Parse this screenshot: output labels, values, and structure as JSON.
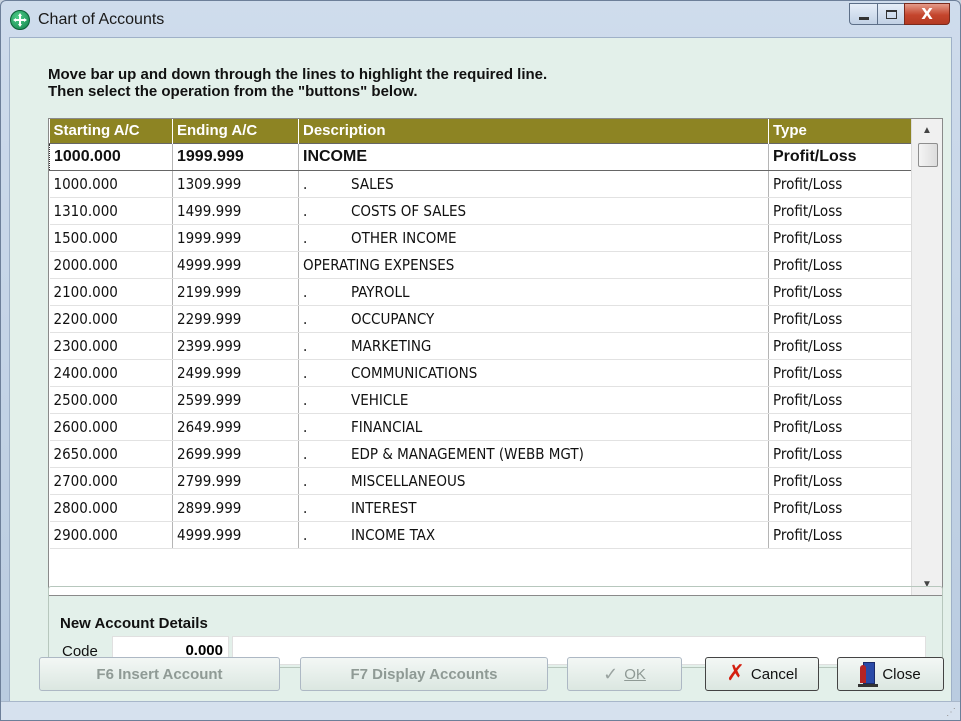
{
  "window": {
    "title": "Chart of Accounts",
    "controls": {
      "minimize": "—",
      "maximize": "□",
      "close": "X"
    }
  },
  "instructions": {
    "line1": "Move bar up and down through the lines to highlight the required line.",
    "line2": "Then select the operation from the \"buttons\" below."
  },
  "grid": {
    "columns": [
      "Starting A/C",
      "Ending A/C",
      "Description",
      "Type"
    ],
    "rows": [
      {
        "start": "1000.000",
        "end": "1999.999",
        "desc": "INCOME",
        "indent": false,
        "type": "Profit/Loss",
        "selected": true
      },
      {
        "start": "1000.000",
        "end": "1309.999",
        "desc": "SALES",
        "indent": true,
        "type": "Profit/Loss"
      },
      {
        "start": "1310.000",
        "end": "1499.999",
        "desc": "COSTS OF SALES",
        "indent": true,
        "type": "Profit/Loss"
      },
      {
        "start": "1500.000",
        "end": "1999.999",
        "desc": "OTHER INCOME",
        "indent": true,
        "type": "Profit/Loss"
      },
      {
        "start": "2000.000",
        "end": "4999.999",
        "desc": "OPERATING EXPENSES",
        "indent": false,
        "type": "Profit/Loss"
      },
      {
        "start": "2100.000",
        "end": "2199.999",
        "desc": "PAYROLL",
        "indent": true,
        "type": "Profit/Loss"
      },
      {
        "start": "2200.000",
        "end": "2299.999",
        "desc": "OCCUPANCY",
        "indent": true,
        "type": "Profit/Loss"
      },
      {
        "start": "2300.000",
        "end": "2399.999",
        "desc": "MARKETING",
        "indent": true,
        "type": "Profit/Loss"
      },
      {
        "start": "2400.000",
        "end": "2499.999",
        "desc": "COMMUNICATIONS",
        "indent": true,
        "type": "Profit/Loss"
      },
      {
        "start": "2500.000",
        "end": "2599.999",
        "desc": "VEHICLE",
        "indent": true,
        "type": "Profit/Loss"
      },
      {
        "start": "2600.000",
        "end": "2649.999",
        "desc": "FINANCIAL",
        "indent": true,
        "type": "Profit/Loss"
      },
      {
        "start": "2650.000",
        "end": "2699.999",
        "desc": "EDP & MANAGEMENT (WEBB MGT)",
        "indent": true,
        "type": "Profit/Loss"
      },
      {
        "start": "2700.000",
        "end": "2799.999",
        "desc": "MISCELLANEOUS",
        "indent": true,
        "type": "Profit/Loss"
      },
      {
        "start": "2800.000",
        "end": "2899.999",
        "desc": "INTEREST",
        "indent": true,
        "type": "Profit/Loss"
      },
      {
        "start": "2900.000",
        "end": "4999.999",
        "desc": "INCOME TAX",
        "indent": true,
        "type": "Profit/Loss"
      }
    ],
    "indent_marker": "."
  },
  "new_account": {
    "legend": "New Account Details",
    "code_label": "Code",
    "code_value": "0.000",
    "name_value": ""
  },
  "buttons": {
    "insert": "F6 Insert Account",
    "display": "F7 Display Accounts",
    "ok": "OK",
    "cancel": "Cancel",
    "close": "Close"
  },
  "colors": {
    "header_bg": "#8d8423",
    "client_bg": "#e3f0ea",
    "cancel_icon": "#d41f0f"
  },
  "icons": {
    "app": "globe-app-icon",
    "ok": "checkmark-icon",
    "cancel": "red-x-icon",
    "close": "exit-door-icon"
  }
}
